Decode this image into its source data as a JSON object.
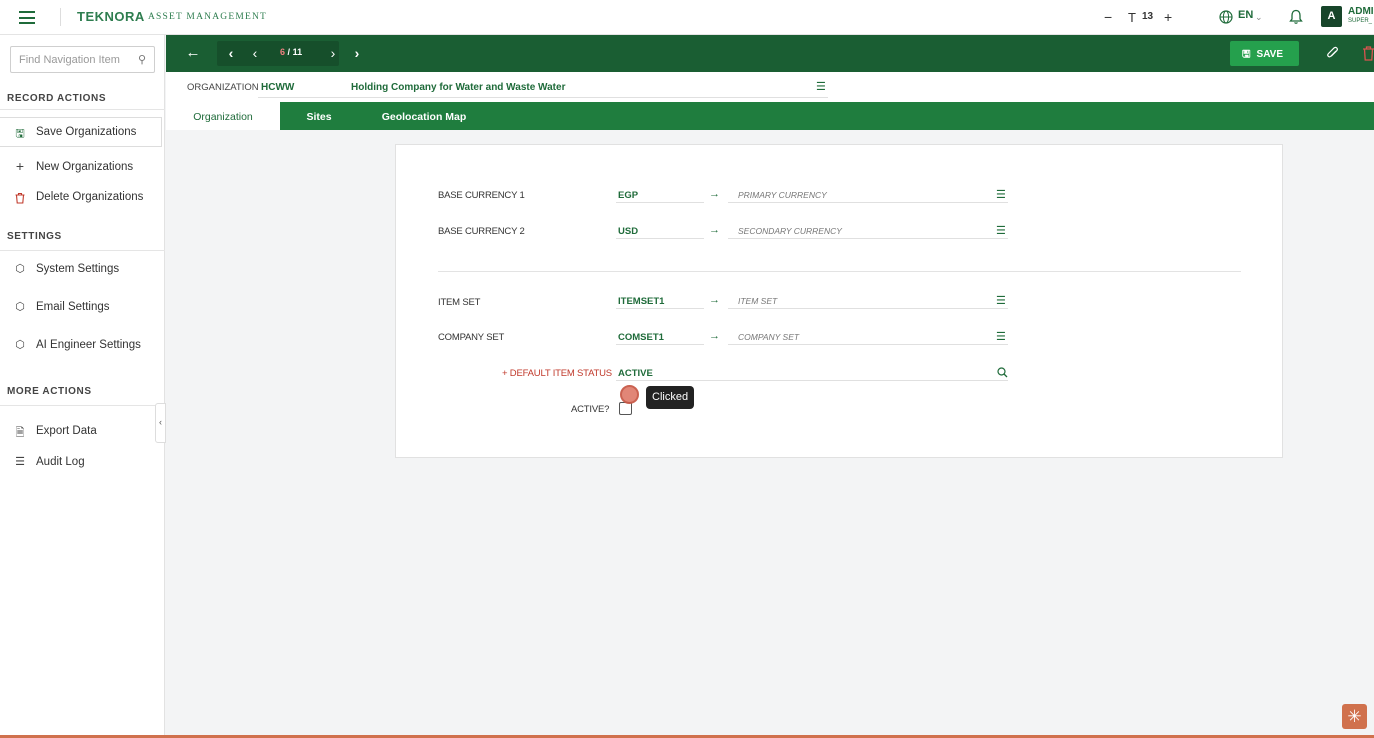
{
  "app": {
    "brand": "TEKNORA",
    "brand_sub": "ASSET MANAGEMENT",
    "font_size_value": "13",
    "language": "EN",
    "avatar_letter": "A",
    "user_name": "ADMI",
    "user_role": "SUPER_"
  },
  "sidebar": {
    "search_placeholder": "Find Navigation Item",
    "record_actions_title": "RECORD ACTIONS",
    "record_actions": [
      {
        "label": "Save Organizations",
        "icon": "save-icon"
      },
      {
        "label": "New Organizations",
        "icon": "plus-icon"
      },
      {
        "label": "Delete Organizations",
        "icon": "trash-icon"
      }
    ],
    "settings_title": "SETTINGS",
    "settings": [
      {
        "label": "System Settings",
        "icon": "cube-icon"
      },
      {
        "label": "Email Settings",
        "icon": "cube-icon"
      },
      {
        "label": "AI Engineer Settings",
        "icon": "cube-icon"
      }
    ],
    "more_title": "MORE ACTIONS",
    "more": [
      {
        "label": "Export Data",
        "icon": "document-icon"
      },
      {
        "label": "Audit Log",
        "icon": "list-icon"
      }
    ]
  },
  "toolbar": {
    "pager_current": "6",
    "pager_sep": "/",
    "pager_total": "11",
    "save_label": "SAVE"
  },
  "record": {
    "label": "ORGANIZATION",
    "code": "HCWW",
    "description": "Holding Company for Water and Waste Water"
  },
  "tabs": [
    "Organization",
    "Sites",
    "Geolocation Map"
  ],
  "form": {
    "base_currency_1": {
      "label": "BASE CURRENCY 1",
      "value": "EGP",
      "desc": "PRIMARY CURRENCY"
    },
    "base_currency_2": {
      "label": "BASE CURRENCY 2",
      "value": "USD",
      "desc": "SECONDARY CURRENCY"
    },
    "item_set": {
      "label": "ITEM SET",
      "value": "ITEMSET1",
      "desc": "ITEM SET"
    },
    "company_set": {
      "label": "COMPANY SET",
      "value": "COMSET1",
      "desc": "COMPANY SET"
    },
    "default_item_status": {
      "label": "+ DEFAULT ITEM STATUS",
      "value": "ACTIVE"
    },
    "active": {
      "label": "ACTIVE?",
      "checked": false
    }
  },
  "tooltip": "Clicked",
  "colors": {
    "primary_green": "#1a5e33",
    "tab_green": "#1f7d3e",
    "save_green": "#25a04d",
    "required_red": "#c0392b",
    "accent_orange": "#d0714d"
  }
}
